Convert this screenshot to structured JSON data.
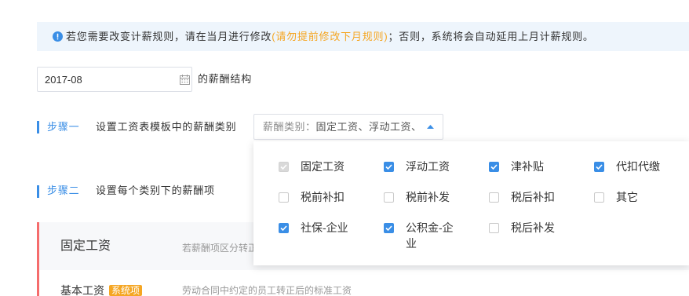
{
  "colors": {
    "accent": "#3a8ee6",
    "warning": "#f5a623",
    "danger": "#f56c6c",
    "notice_bg": "#eef5fc",
    "header_bg": "#f7f8fa"
  },
  "notice": {
    "icon": "info-circle-icon",
    "text_before": "若您需要改变计薪规则，请在当月进行修改",
    "text_highlight": "(请勿提前修改下月规则)",
    "text_after": "；否则，系统将会自动延用上月计薪规则。"
  },
  "month_picker": {
    "value": "2017-08",
    "icon": "calendar-icon",
    "suffix": "的薪酬结构"
  },
  "step1": {
    "label": "步骤一",
    "title": "设置工资表模板中的薪酬类别",
    "dropdown": {
      "prefix": "薪酬类别：",
      "value": "固定工资、浮动工资、",
      "icon": "caret-up-icon",
      "expanded": true
    },
    "options": [
      {
        "label": "固定工资",
        "checked": true,
        "disabled": true
      },
      {
        "label": "浮动工资",
        "checked": true,
        "disabled": false
      },
      {
        "label": "津补贴",
        "checked": true,
        "disabled": false
      },
      {
        "label": "代扣代缴",
        "checked": true,
        "disabled": false
      },
      {
        "label": "税前补扣",
        "checked": false,
        "disabled": false
      },
      {
        "label": "税前补发",
        "checked": false,
        "disabled": false
      },
      {
        "label": "税后补扣",
        "checked": false,
        "disabled": false
      },
      {
        "label": "其它",
        "checked": false,
        "disabled": false
      },
      {
        "label": "社保-企业",
        "checked": true,
        "disabled": false
      },
      {
        "label": "公积金-企业",
        "checked": true,
        "disabled": false
      },
      {
        "label": "税后补发",
        "checked": false,
        "disabled": false
      }
    ]
  },
  "step2": {
    "label": "步骤二",
    "title": "设置每个类别下的薪酬项"
  },
  "category_card": {
    "title": "固定工资",
    "hint": "若薪酬项区分转正",
    "items": [
      {
        "name": "基本工资",
        "badge": "系统项",
        "description": "劳动合同中约定的员工转正后的标准工资"
      }
    ]
  }
}
